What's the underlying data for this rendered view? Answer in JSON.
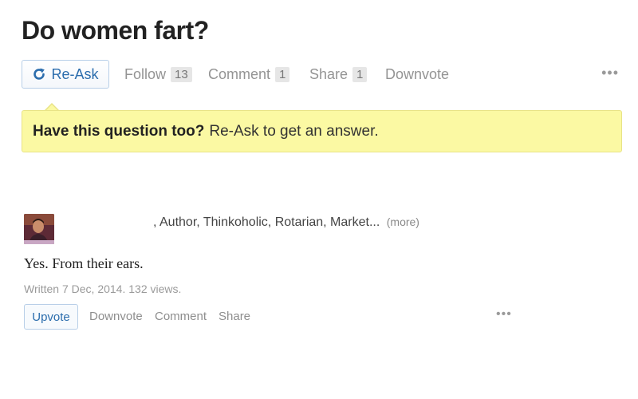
{
  "question": {
    "title": "Do women fart?"
  },
  "action_bar": {
    "reask_label": "Re-Ask",
    "follow_label": "Follow",
    "follow_count": "13",
    "comment_label": "Comment",
    "comment_count": "1",
    "share_label": "Share",
    "share_count": "1",
    "downvote_label": "Downvote",
    "more_icon": "more-horizontal-icon",
    "reask_icon": "refresh-icon"
  },
  "notice": {
    "bold_text": "Have this question too?",
    "text": "Re-Ask to get an answer."
  },
  "answer": {
    "credentials": ", Author, Thinkoholic, Rotarian, Market...",
    "more_link": "(more)",
    "text": "Yes. From their ears.",
    "meta": "Written 7 Dec, 2014. 132 views.",
    "upvote_label": "Upvote",
    "downvote_label": "Downvote",
    "comment_label": "Comment",
    "share_label": "Share",
    "more_icon": "more-horizontal-icon"
  },
  "colors": {
    "accent": "#2b6dad",
    "notice_bg": "#fbf9a3",
    "muted_text": "#949494"
  }
}
